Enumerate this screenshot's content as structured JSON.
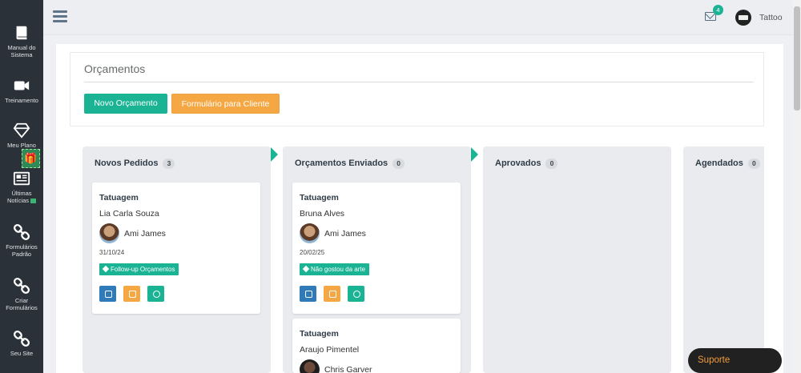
{
  "sidebar": {
    "items": [
      {
        "label_line1": "Manual do",
        "label_line2": "Sistema",
        "icon": "book-icon"
      },
      {
        "label_line1": "Treinamento",
        "label_line2": "",
        "icon": "video-camera-icon"
      },
      {
        "label_line1": "Meu Plano",
        "label_line2": "",
        "icon": "diamond-icon"
      },
      {
        "label_line1": "Últimas",
        "label_line2": "Notícias",
        "icon": "newspaper-icon"
      },
      {
        "label_line1": "Formulários",
        "label_line2": "Padrão",
        "icon": "link-icon"
      },
      {
        "label_line1": "Criar",
        "label_line2": "Formulários",
        "icon": "link-icon"
      },
      {
        "label_line1": "Seu Site",
        "label_line2": "",
        "icon": "link-icon"
      }
    ]
  },
  "topbar": {
    "mail_count": "4",
    "user_name": "Tattoo"
  },
  "panel": {
    "title": "Orçamentos",
    "new_button": "Novo Orçamento",
    "form_button": "Formulário para Cliente"
  },
  "columns": [
    {
      "title": "Novos Pedidos",
      "count": "3",
      "cards": [
        {
          "type": "Tatuagem",
          "client": "Lia Carla Souza",
          "artist": "Ami James",
          "date": "31/10/24",
          "tag": "Follow-up Orçamentos"
        }
      ]
    },
    {
      "title": "Orçamentos Enviados",
      "count": "0",
      "cards": [
        {
          "type": "Tatuagem",
          "client": "Bruna Alves",
          "artist": "Ami James",
          "date": "20/02/25",
          "tag": "Não gostou da arte"
        },
        {
          "type": "Tatuagem",
          "client": "Araujo Pimentel",
          "artist": "Chris Garver"
        }
      ]
    },
    {
      "title": "Aprovados",
      "count": "0",
      "cards": []
    },
    {
      "title": "Agendados",
      "count": "0",
      "cards": []
    }
  ],
  "support": {
    "label": "Suporte"
  },
  "colors": {
    "sidebar": "#2b3138",
    "accent_green": "#1ab394",
    "accent_orange": "#f4a742",
    "edit_blue": "#2f7ab9"
  }
}
